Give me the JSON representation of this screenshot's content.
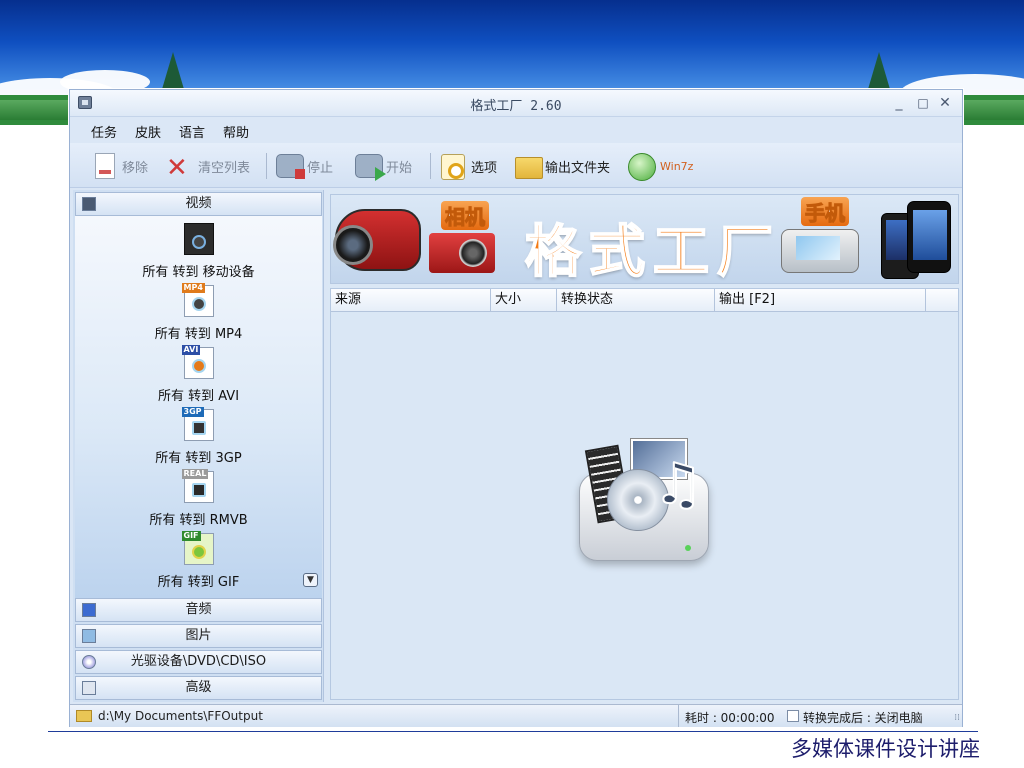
{
  "window": {
    "title": "格式工厂 2.60",
    "controls": {
      "minimize": "_",
      "maximize": "□",
      "close": "✕"
    }
  },
  "menu": [
    "任务",
    "皮肤",
    "语言",
    "帮助"
  ],
  "toolbar": {
    "remove": "移除",
    "clear_list": "清空列表",
    "stop": "停止",
    "start": "开始",
    "options": "选项",
    "output_folder": "输出文件夹",
    "win7z": "Win7z"
  },
  "sidebar": {
    "video_header": "视频",
    "video_items": [
      {
        "label": "所有 转到 移动设备",
        "tag": ""
      },
      {
        "label": "所有 转到 MP4",
        "tag": "MP4"
      },
      {
        "label": "所有 转到 AVI",
        "tag": "AVI"
      },
      {
        "label": "所有 转到 3GP",
        "tag": "3GP"
      },
      {
        "label": "所有 转到 RMVB",
        "tag": "REAL"
      },
      {
        "label": "所有 转到 GIF",
        "tag": "GIF"
      }
    ],
    "audio": "音频",
    "picture": "图片",
    "optical": "光驱设备\\DVD\\CD\\ISO",
    "advanced": "高级"
  },
  "banner": {
    "camera_label": "相机",
    "brand": "格式工厂",
    "phone_label": "手机"
  },
  "table": {
    "columns": [
      "来源",
      "大小",
      "转换状态",
      "输出 [F2]"
    ]
  },
  "statusbar": {
    "output_path": "d:\\My Documents\\FFOutput",
    "elapsed": "耗时 : 00:00:00",
    "after_convert": "转换完成后 : 关闭电脑"
  },
  "slide": {
    "footer": "多媒体课件设计讲座"
  }
}
